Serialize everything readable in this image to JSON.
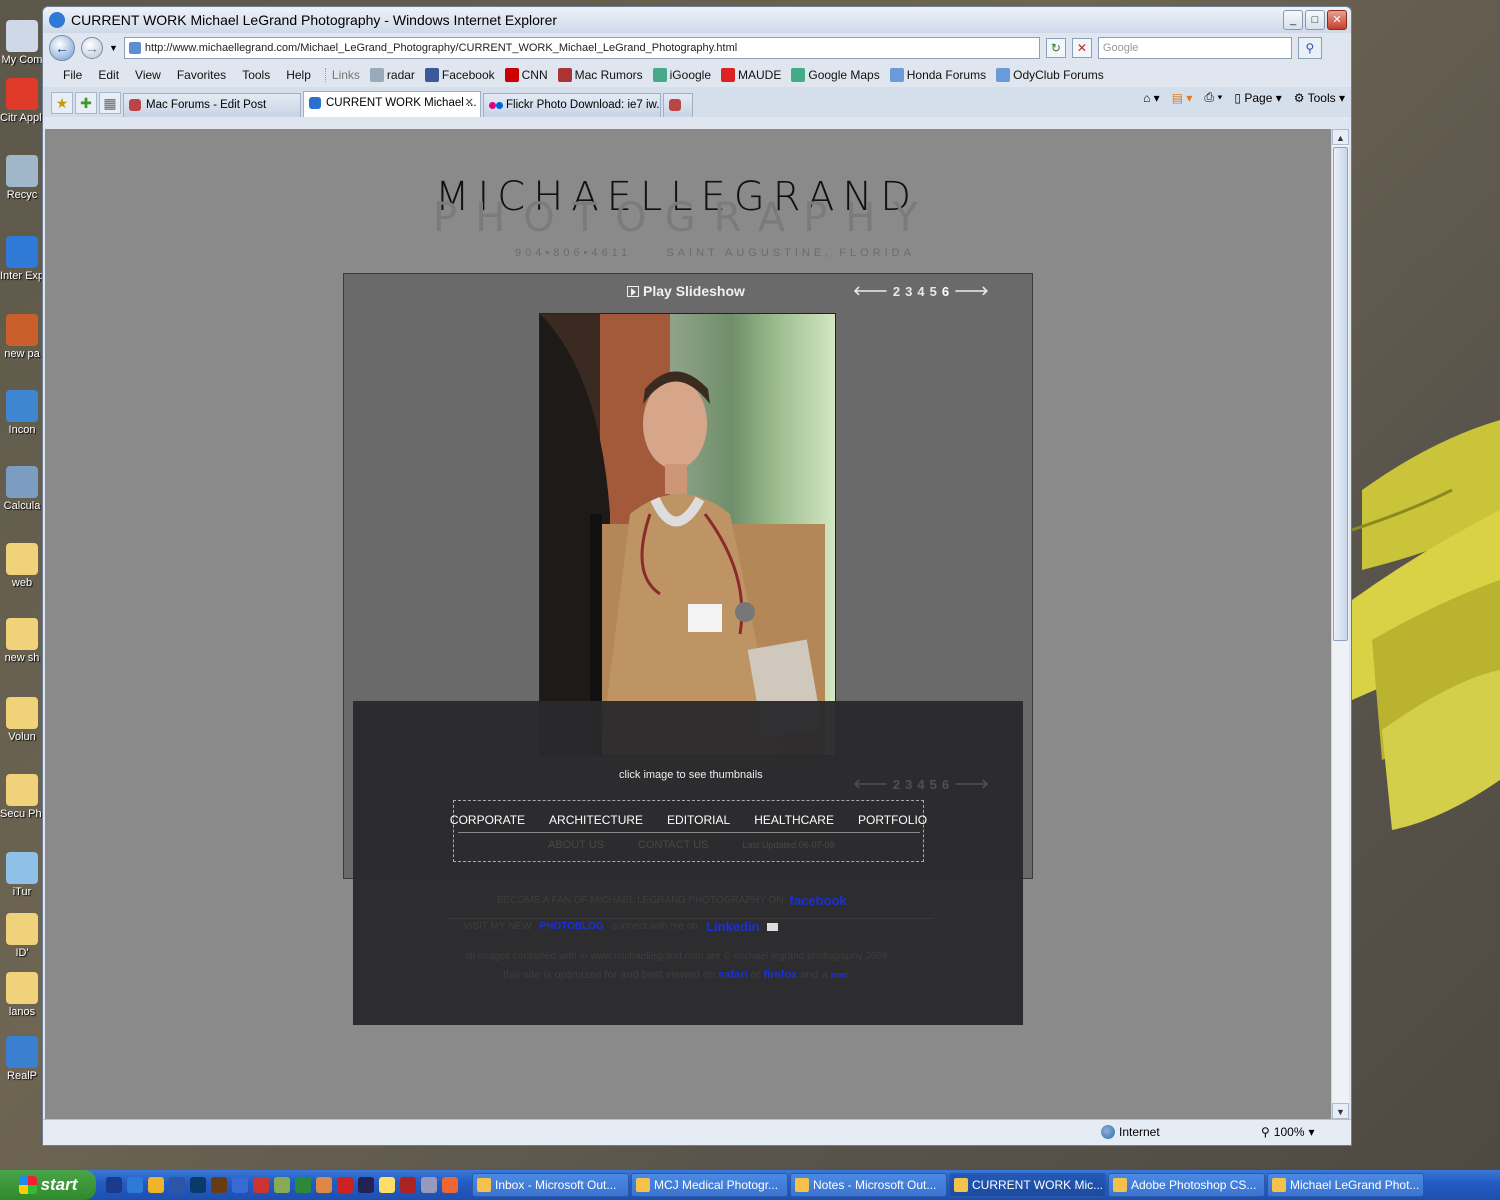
{
  "desktop": {
    "icons": [
      "My Com",
      "Citr Applica",
      "Recyc",
      "Inter Explo",
      "new pa",
      "Incon",
      "Calcula",
      "web",
      "new sh",
      "Volun",
      "Secu Pho",
      "iTur",
      "ID'",
      "lanos",
      "RealP"
    ]
  },
  "window": {
    "title": "CURRENT WORK Michael LeGrand Photography - Windows Internet Explorer",
    "url": "http://www.michaellegrand.com/Michael_LeGrand_Photography/CURRENT_WORK_Michael_LeGrand_Photography.html",
    "search_placeholder": "Google"
  },
  "menu": [
    "File",
    "Edit",
    "View",
    "Favorites",
    "Tools",
    "Help"
  ],
  "links": {
    "label": "Links",
    "items": [
      "radar",
      "Facebook",
      "CNN",
      "Mac Rumors",
      "iGoogle",
      "MAUDE",
      "Google Maps",
      "Honda Forums",
      "OdyClub Forums"
    ]
  },
  "tabs": [
    "Mac Forums - Edit Post",
    "CURRENT WORK Michael ...",
    "Flickr Photo Download: ie7 iw..."
  ],
  "commands": {
    "page": "Page",
    "tools": "Tools"
  },
  "site": {
    "logo_top": "MICHAELLEGRAND",
    "logo_bottom": "PHOTOGRAPHY",
    "phone": "904•806•4611",
    "location": "SAINT AUGUSTINE, FLORIDA",
    "slideshow": "Play Slideshow",
    "pages": [
      "2",
      "3",
      "4",
      "5",
      "6"
    ],
    "current_page": "6",
    "click_hint": "click image to see thumbnails",
    "nav_main": [
      "CORPORATE",
      "ARCHITECTURE",
      "EDITORIAL",
      "HEALTHCARE",
      "PORTFOLIO"
    ],
    "nav_about": "ABOUT US",
    "nav_contact": "CONTACT US",
    "updated": "Last Updated 06-07-09",
    "fan_text": "BECOME A FAN OF MICHAEL LEGRAND PHOTOGRAPHY ON",
    "facebook": "facebook",
    "visit_text": "VISIT MY NEW",
    "photoblog": "PHOTOBLOG",
    "connect_text": "connect with me on",
    "linkedin": "Linkedin",
    "copyright": "all images contained with in www.michaellegrand.com are © michael legrand photography 2009",
    "optimized_pre": "this site is optimized for and best viewed on",
    "safari": "safari",
    "or": "or",
    "firefox": "firefox",
    "and_a": "and a",
    "mac": "mac"
  },
  "status": {
    "zone": "Internet",
    "zoom": "100%"
  },
  "taskbar": {
    "start": "start",
    "tasks": [
      "Inbox - Microsoft Out...",
      "MCJ Medical Photogr...",
      "Notes - Microsoft Out...",
      "CURRENT WORK Mic...",
      "Adobe Photoshop CS...",
      "Michael LeGrand Phot..."
    ]
  }
}
